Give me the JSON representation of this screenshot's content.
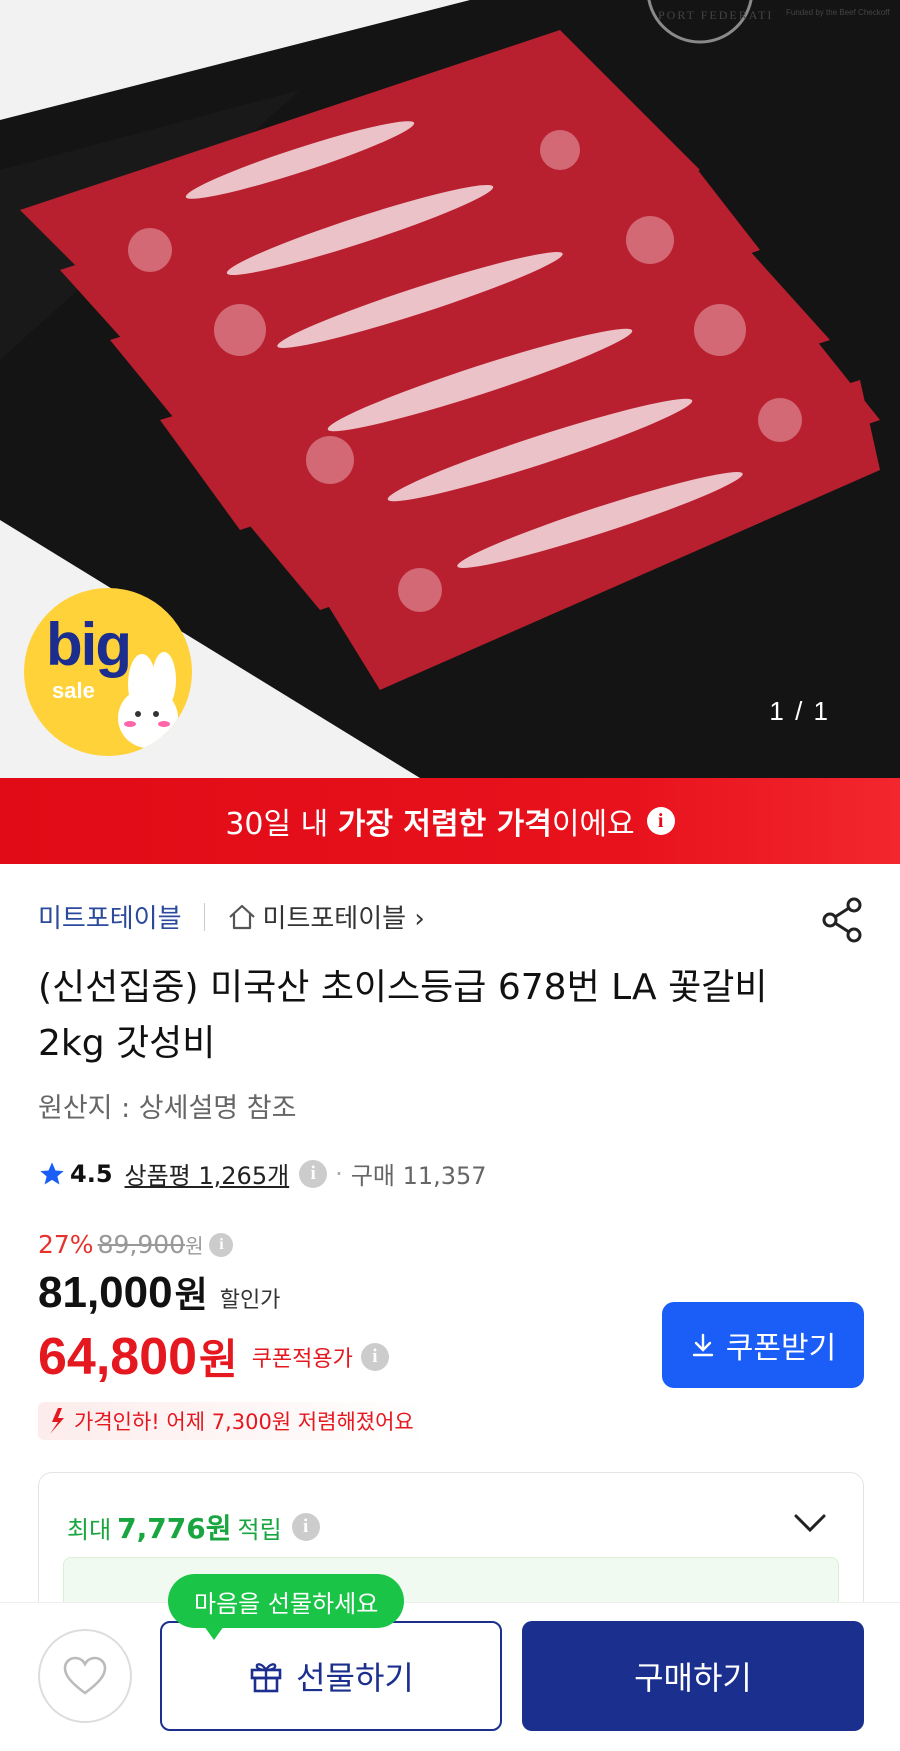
{
  "gallery": {
    "pager": "1 / 1",
    "badge_big": "big",
    "badge_sale": "sale",
    "watermark_1": "PORT FEDERATI",
    "watermark_2": "Funded by the Beef Checkoff"
  },
  "banner": {
    "prefix": "30일 내 ",
    "strong": "가장 저렴한 가격",
    "suffix": "이에요"
  },
  "seller": {
    "name": "미트포테이블",
    "store_link": "미트포테이블 ›"
  },
  "product": {
    "title": "(신선집중) 미국산 초이스등급 678번 LA 꽃갈비 2kg 갓성비",
    "origin": "원산지 : 상세설명 참조"
  },
  "rating": {
    "score": "4.5",
    "reviews": "상품평 1,265개",
    "purchases": "구매 11,357"
  },
  "price": {
    "discount_pct": "27%",
    "original": "89,900",
    "original_unit": "원",
    "sale": "81,000",
    "sale_unit": "원",
    "sale_label": "할인가",
    "coupon": "64,800",
    "coupon_unit": "원",
    "coupon_label": "쿠폰적용가",
    "coupon_button": "쿠폰받기",
    "drop_notice": "가격인하! 어제 7,300원 저렴해졌어요"
  },
  "points": {
    "prefix": "최대",
    "amount": "7,776원",
    "suffix": "적립"
  },
  "bottom": {
    "gift_tooltip": "마음을 선물하세요",
    "gift": "선물하기",
    "buy": "구매하기"
  },
  "colors": {
    "banner_red": "#e10b17",
    "price_red": "#e5171f",
    "brand_navy": "#1b2f8e",
    "coupon_blue": "#1a5ef7",
    "points_green": "#19a53f",
    "tooltip_green": "#19c446"
  }
}
